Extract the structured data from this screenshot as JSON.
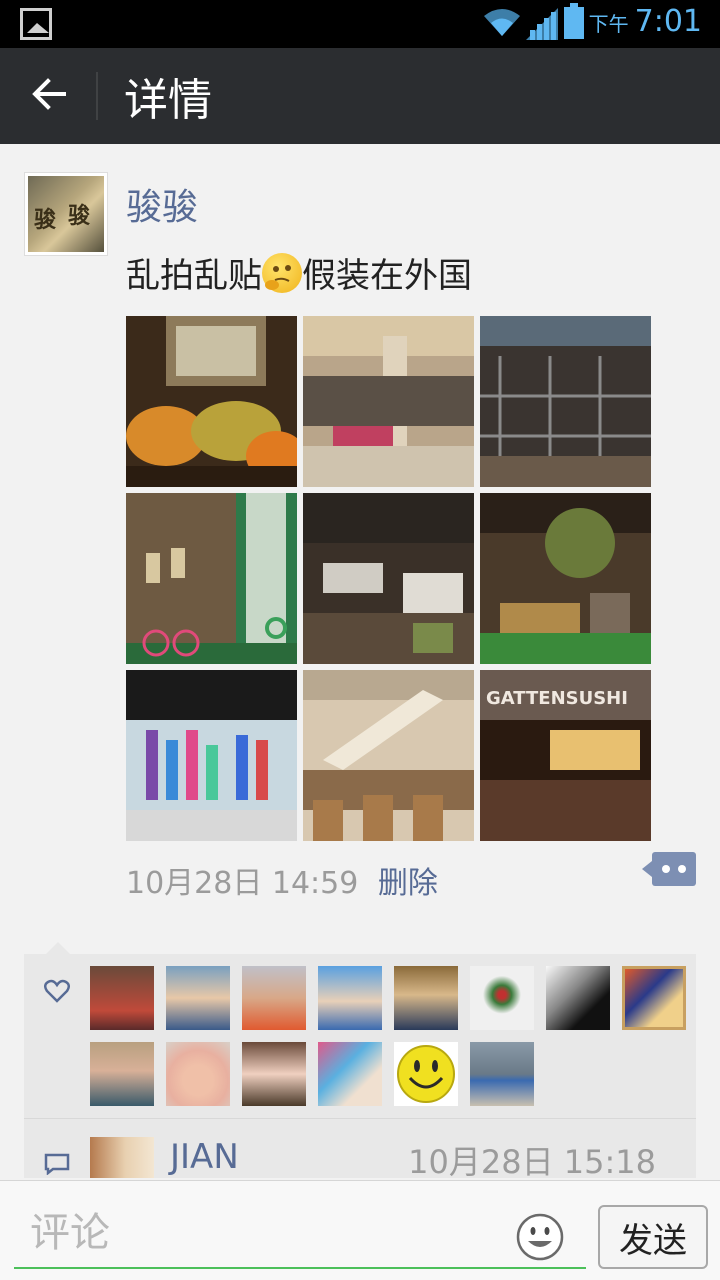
{
  "status_bar": {
    "ampm": "下午",
    "time": "7:01",
    "accent_color": "#5fb8f2"
  },
  "header": {
    "title": "详情",
    "back_icon": "arrow-left-icon",
    "background": "#2b2d30"
  },
  "post": {
    "avatar_text": "骏骏",
    "username": "骏骏",
    "text_before_emoji": "乱拍乱贴",
    "emoji": "thinking-face-icon",
    "text_after_emoji": "假装在外国",
    "photos": [
      {
        "subject": "fruit market display"
      },
      {
        "subject": "shop interior with shoes"
      },
      {
        "subject": "clothing shelves store"
      },
      {
        "subject": "corridor with bicycle"
      },
      {
        "subject": "RGF store counters"
      },
      {
        "subject": "cafe with plants"
      },
      {
        "subject": "glass bottles display"
      },
      {
        "subject": "escalator food court"
      },
      {
        "subject": "GATTENSUSHI restaurant"
      }
    ],
    "timestamp": "10月28日 14:59",
    "delete_label": "删除",
    "name_color": "#576b95"
  },
  "likes": {
    "icon": "heart-icon",
    "avatars": [
      "avatar-1",
      "avatar-2",
      "avatar-3",
      "avatar-4",
      "avatar-5",
      "avatar-6",
      "avatar-7",
      "avatar-8",
      "avatar-9",
      "avatar-10",
      "avatar-11",
      "avatar-12",
      "avatar-13",
      "avatar-14"
    ]
  },
  "comments": [
    {
      "name": "JIAN",
      "time": "10月28日 15:18",
      "icon": "comment-bubble-icon"
    }
  ],
  "input_bar": {
    "placeholder": "评论",
    "emoji_icon": "smiley-face-icon",
    "send_label": "发送",
    "accent_color": "#4cc05a"
  }
}
